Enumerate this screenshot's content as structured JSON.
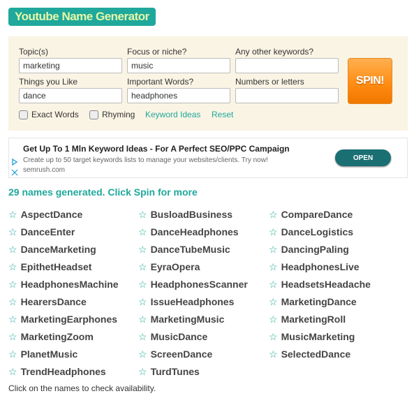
{
  "title": "Youtube Name Generator",
  "form": {
    "topics_label": "Topic(s)",
    "topics_value": "marketing",
    "focus_label": "Focus or niche?",
    "focus_value": "music",
    "keywords_label": "Any other keywords?",
    "keywords_value": "",
    "likes_label": "Things you Like",
    "likes_value": "dance",
    "important_label": "Important Words?",
    "important_value": "headphones",
    "numbers_label": "Numbers or letters",
    "numbers_value": "",
    "spin_label": "SPIN!",
    "exact_label": "Exact Words",
    "rhyming_label": "Rhyming",
    "keyword_ideas": "Keyword Ideas",
    "reset": "Reset"
  },
  "ad": {
    "headline": "Get Up To 1 Mln Keyword Ideas - For A Perfect SEO/PPC Campaign",
    "text": "Create up to 50 target keywords lists to manage your websites/clients. Try now!",
    "source": "semrush.com",
    "open_label": "OPEN"
  },
  "results": {
    "count_text": "29 names generated. Click Spin for more",
    "star_icon": "☆",
    "names": [
      "AspectDance",
      "BusloadBusiness",
      "CompareDance",
      "DanceEnter",
      "DanceHeadphones",
      "DanceLogistics",
      "DanceMarketing",
      "DanceTubeMusic",
      "DancingPaling",
      "EpithetHeadset",
      "EyraOpera",
      "HeadphonesLive",
      "HeadphonesMachine",
      "HeadphonesScanner",
      "HeadsetsHeadache",
      "HearersDance",
      "IssueHeadphones",
      "MarketingDance",
      "MarketingEarphones",
      "MarketingMusic",
      "MarketingRoll",
      "MarketingZoom",
      "MusicDance",
      "MusicMarketing",
      "PlanetMusic",
      "ScreenDance",
      "SelectedDance",
      "TrendHeadphones",
      "TurdTunes"
    ]
  },
  "footer": "Click on the names to check availability.",
  "colors": {
    "accent": "#1fa89b",
    "spin": "#ff8a10",
    "open": "#1a6f73"
  }
}
